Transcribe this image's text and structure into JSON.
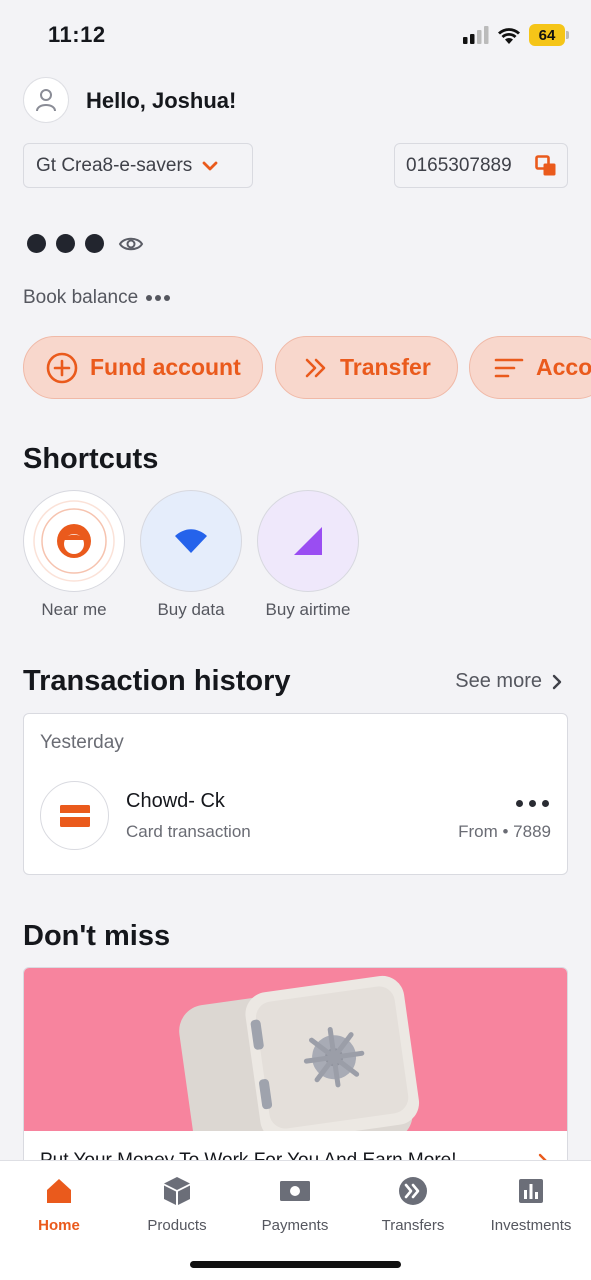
{
  "status_bar": {
    "time": "11:12",
    "battery": "64"
  },
  "header": {
    "greeting": "Hello, Joshua!"
  },
  "account": {
    "name": "Gt Crea8-e-savers",
    "number": "0165307889"
  },
  "balance": {
    "label": "Book balance"
  },
  "actions": [
    {
      "label": "Fund account",
      "icon": "plus-circle-icon"
    },
    {
      "label": "Transfer",
      "icon": "double-chevron-icon"
    },
    {
      "label": "Acco",
      "icon": "menu-lines-icon"
    }
  ],
  "shortcuts": {
    "title": "Shortcuts",
    "items": [
      {
        "label": "Near me",
        "icon": "location-face-icon"
      },
      {
        "label": "Buy data",
        "icon": "wifi-icon"
      },
      {
        "label": "Buy airtime",
        "icon": "signal-triangle-icon"
      }
    ]
  },
  "transactions": {
    "title": "Transaction history",
    "see_more": "See more",
    "day": "Yesterday",
    "items": [
      {
        "name": "Chowd- Ck",
        "type": "Card transaction",
        "from": "From • 7889",
        "icon": "card-icon"
      }
    ]
  },
  "dont_miss": {
    "title": "Don't miss",
    "promo_text": "Put Your Money To Work For You And Earn More!"
  },
  "bottom_nav": {
    "items": [
      {
        "label": "Home",
        "icon": "home-icon",
        "active": true
      },
      {
        "label": "Products",
        "icon": "box-icon"
      },
      {
        "label": "Payments",
        "icon": "payment-icon"
      },
      {
        "label": "Transfers",
        "icon": "transfer-icon"
      },
      {
        "label": "Investments",
        "icon": "chart-icon"
      }
    ]
  },
  "colors": {
    "accent": "#ea5a1c",
    "pill_bg": "#f8d7cc",
    "promo_bg": "#f7849e",
    "background": "#f3f3f6"
  }
}
